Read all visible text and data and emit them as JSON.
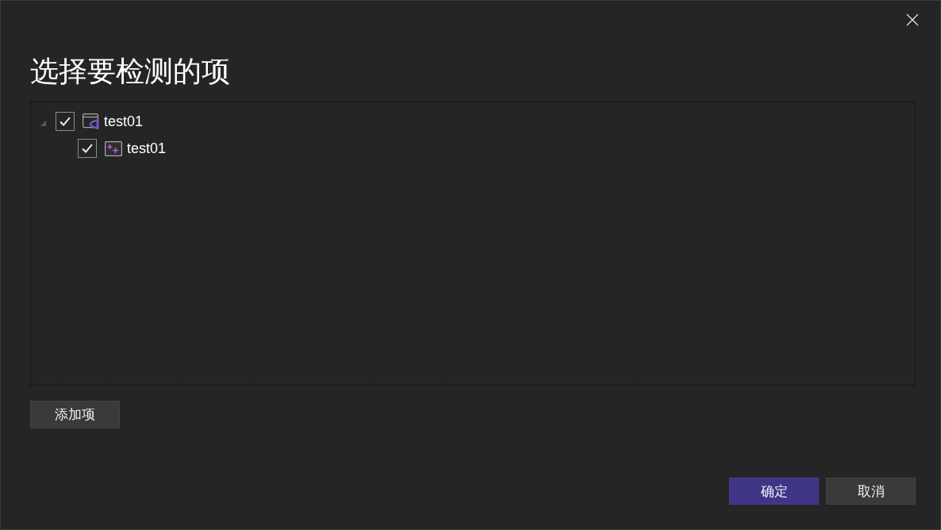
{
  "dialog": {
    "title": "选择要检测的项",
    "tree": [
      {
        "label": "test01",
        "kind": "project",
        "checked": true,
        "expanded": true,
        "children": [
          {
            "label": "test01",
            "kind": "item",
            "checked": true
          }
        ]
      }
    ],
    "add_button": "添加项",
    "buttons": [
      {
        "label": "确定",
        "kind": "primary"
      },
      {
        "label": "取消",
        "kind": "secondary"
      }
    ]
  }
}
